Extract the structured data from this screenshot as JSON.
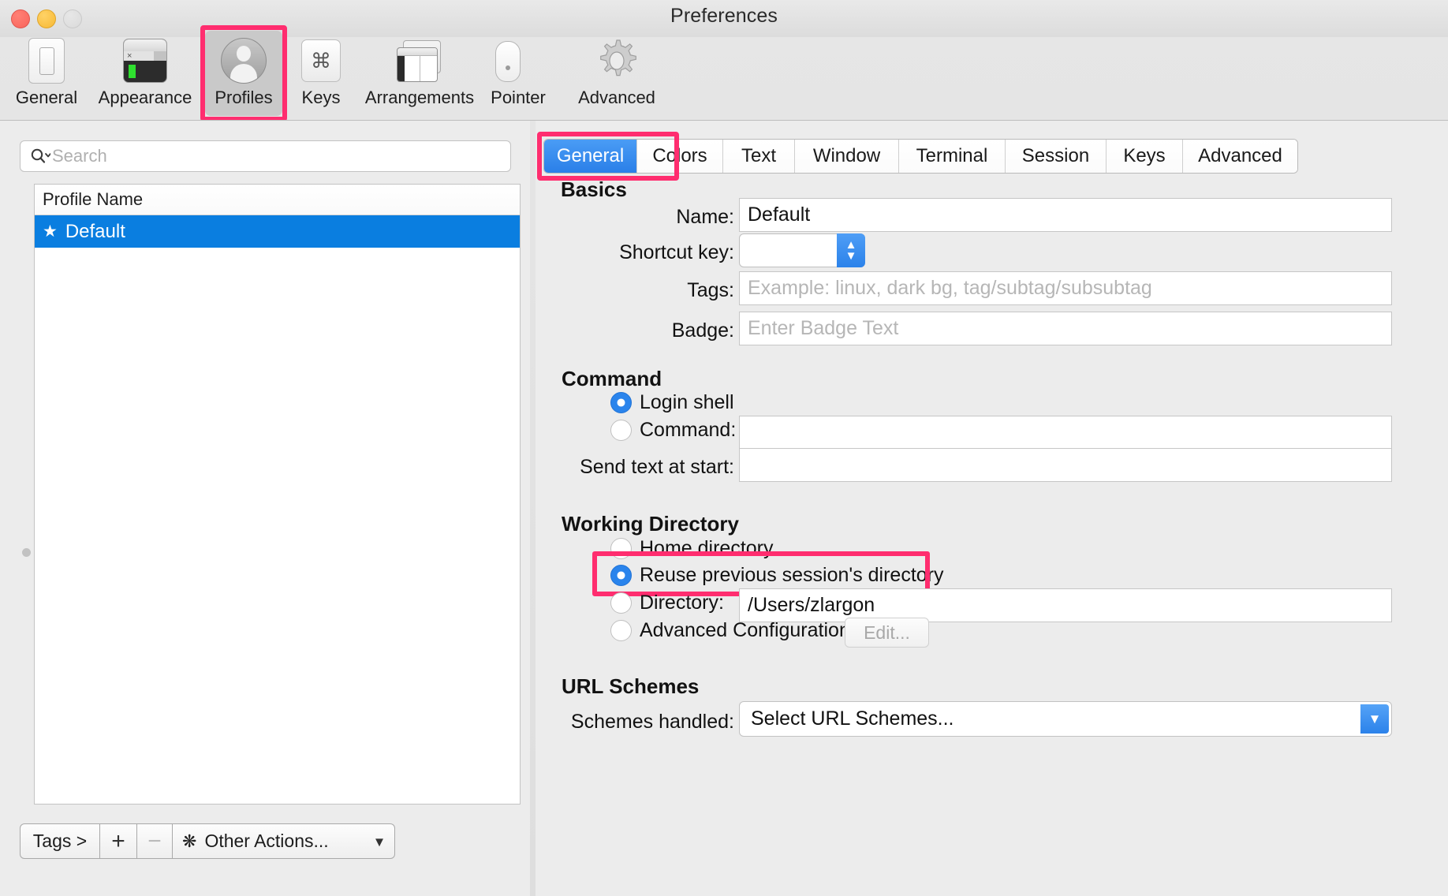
{
  "window": {
    "title": "Preferences",
    "traffic_lights": [
      "close",
      "minimize",
      "zoom"
    ]
  },
  "toolbar": {
    "items": [
      {
        "label": "General",
        "icon": "window-prefs-icon",
        "selected": false
      },
      {
        "label": "Appearance",
        "icon": "terminal-appearance-icon",
        "selected": false
      },
      {
        "label": "Profiles",
        "icon": "user-silhouette-icon",
        "selected": true
      },
      {
        "label": "Keys",
        "icon": "command-key-icon",
        "selected": false
      },
      {
        "label": "Arrangements",
        "icon": "window-arrangements-icon",
        "selected": false
      },
      {
        "label": "Pointer",
        "icon": "mouse-trackpad-icon",
        "selected": false
      },
      {
        "label": "Advanced",
        "icon": "gear-icon",
        "selected": false
      }
    ]
  },
  "sidebar": {
    "search": {
      "placeholder": "Search",
      "value": "",
      "icon": "search-icon"
    },
    "profile_list": {
      "column_header": "Profile Name",
      "rows": [
        {
          "star": "★",
          "name": "Default",
          "selected": true
        }
      ]
    },
    "bottom_bar": {
      "tags_label": "Tags >",
      "add_label": "+",
      "remove_label": "−",
      "other_actions_label": "Other Actions...",
      "other_actions_icon": "gear-icon",
      "chevron_icon": "chevron-down-icon"
    }
  },
  "tabs": [
    {
      "label": "General",
      "active": true,
      "highlighted": true
    },
    {
      "label": "Colors",
      "active": false
    },
    {
      "label": "Text",
      "active": false
    },
    {
      "label": "Window",
      "active": false
    },
    {
      "label": "Terminal",
      "active": false
    },
    {
      "label": "Session",
      "active": false
    },
    {
      "label": "Keys",
      "active": false
    },
    {
      "label": "Advanced",
      "active": false
    }
  ],
  "general": {
    "basics": {
      "heading": "Basics",
      "name_label": "Name:",
      "name_value": "Default",
      "shortcut_label": "Shortcut key:",
      "shortcut_value": "",
      "tags_label": "Tags:",
      "tags_placeholder": "Example: linux, dark bg, tag/subtag/subsubtag",
      "badge_label": "Badge:",
      "badge_placeholder": "Enter Badge Text"
    },
    "command": {
      "heading": "Command",
      "options": [
        {
          "label": "Login shell",
          "selected": true
        },
        {
          "label": "Command:",
          "selected": false
        }
      ],
      "command_value": "",
      "send_text_label": "Send text at start:",
      "send_text_value": ""
    },
    "working_directory": {
      "heading": "Working Directory",
      "options": [
        {
          "label": "Home directory",
          "selected": false,
          "highlighted": false
        },
        {
          "label": "Reuse previous session's directory",
          "selected": true,
          "highlighted": true
        },
        {
          "label": "Directory:",
          "selected": false,
          "highlighted": false
        },
        {
          "label": "Advanced Configuration",
          "selected": false,
          "highlighted": false
        }
      ],
      "directory_value": "/Users/zlargon",
      "edit_button_label": "Edit..."
    },
    "url_schemes": {
      "heading": "URL Schemes",
      "schemes_label": "Schemes handled:",
      "schemes_value": "Select URL Schemes...",
      "dropdown_icon": "chevron-down-icon"
    }
  },
  "colors": {
    "highlight": "#ff2d6f",
    "accent": "#2a84ec",
    "selection": "#0a7ee0"
  }
}
